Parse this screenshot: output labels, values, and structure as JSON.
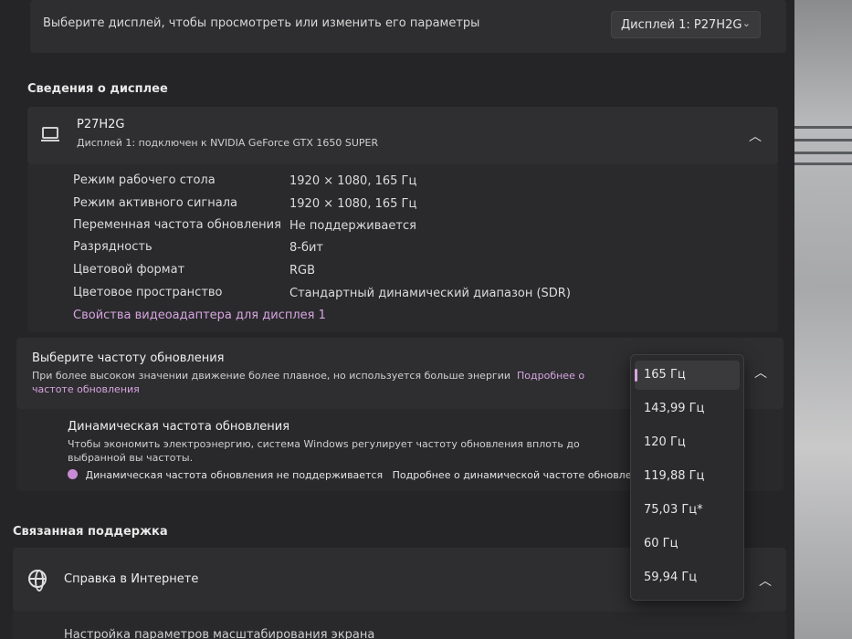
{
  "top": {
    "prompt": "Выберите дисплей, чтобы просмотреть или изменить его параметры",
    "display_select": "Дисплей 1: P27H2G"
  },
  "display_info": {
    "section_title": "Сведения о дисплее",
    "name": "P27H2G",
    "subtitle": "Дисплей 1: подключен к NVIDIA GeForce GTX 1650 SUPER",
    "rows": [
      {
        "label": "Режим рабочего стола",
        "value": "1920 × 1080, 165 Гц"
      },
      {
        "label": "Режим активного сигнала",
        "value": "1920 × 1080, 165 Гц"
      },
      {
        "label": "Переменная частота обновления",
        "value": "Не поддерживается"
      },
      {
        "label": "Разрядность",
        "value": "8-бит"
      },
      {
        "label": "Цветовой формат",
        "value": "RGB"
      },
      {
        "label": "Цветовое пространство",
        "value": "Стандартный динамический диапазон (SDR)"
      }
    ],
    "adapter_link": "Свойства видеоадаптера для дисплея 1"
  },
  "refresh": {
    "title": "Выберите частоту обновления",
    "desc": "При более высоком значении движение более плавное, но используется больше энергии",
    "learn_more": "Подробнее о частоте обновления",
    "options": [
      "165 Гц",
      "143,99 Гц",
      "120 Гц",
      "119,88 Гц",
      "75,03 Гц*",
      "60 Гц",
      "59,94 Гц"
    ],
    "selected": "165 Гц"
  },
  "dynamic": {
    "title": "Динамическая частота обновления",
    "desc": "Чтобы экономить электроэнергию, система Windows регулирует частоту обновления вплоть до выбранной вы частоты.",
    "warning": "Динамическая частота обновления не поддерживается",
    "learn_more": "Подробнее о динамической частоте обновления"
  },
  "support": {
    "section_title": "Связанная поддержка",
    "help_label": "Справка в Интернете",
    "next_label": "Настройка параметров масштабирования экрана"
  },
  "colors": {
    "accent": "#d7a4e0",
    "background": "#252527",
    "card": "#2e2e30"
  }
}
